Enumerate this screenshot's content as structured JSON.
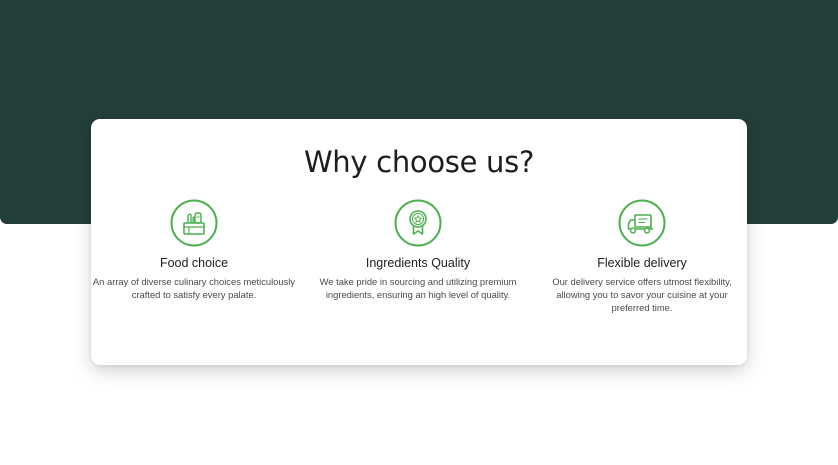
{
  "section": {
    "title": "Why choose us?"
  },
  "features": [
    {
      "icon": "grocery-basket-icon",
      "title": "Food choice",
      "description": "An array of diverse culinary choices meticulously crafted to satisfy every palate."
    },
    {
      "icon": "award-badge-icon",
      "title": "Ingredients Quality",
      "description": "We take pride in sourcing and utilizing premium ingredients, ensuring an high level of quality."
    },
    {
      "icon": "delivery-truck-icon",
      "title": "Flexible delivery",
      "description": "Our delivery service offers utmost flexibility, allowing you to savor your  cuisine at your preferred time."
    }
  ],
  "colors": {
    "hero_background": "#243e3a",
    "icon_accent": "#4caf50",
    "card_background": "#ffffff"
  }
}
